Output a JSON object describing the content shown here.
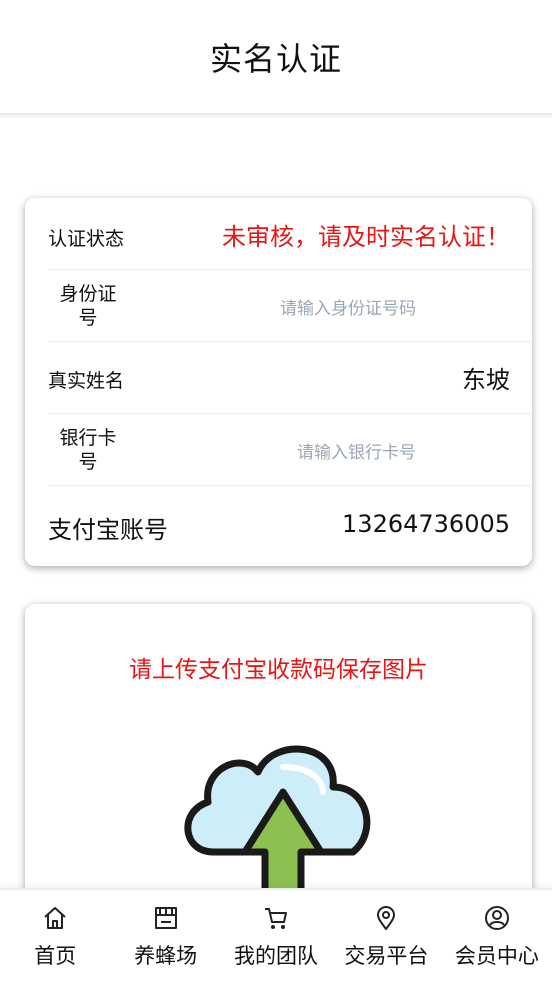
{
  "header": {
    "title": "实名认证"
  },
  "verification": {
    "status_label": "认证状态",
    "status_value": "未审核，请及时实名认证！",
    "id_label": "身份证号",
    "id_placeholder": "请输入身份证号码",
    "name_label": "真实姓名",
    "name_value": "东坡",
    "bank_label": "银行卡号",
    "bank_placeholder": "请输入银行卡号",
    "alipay_label": "支付宝账号",
    "alipay_value": "13264736005"
  },
  "upload": {
    "title": "请上传支付宝收款码保存图片",
    "icon": "cloud-upload-icon"
  },
  "tabbar": {
    "items": [
      {
        "label": "首页",
        "icon": "home-icon"
      },
      {
        "label": "养蜂场",
        "icon": "store-icon"
      },
      {
        "label": "我的团队",
        "icon": "cart-icon"
      },
      {
        "label": "交易平台",
        "icon": "location-icon"
      },
      {
        "label": "会员中心",
        "icon": "user-circle-icon"
      }
    ]
  },
  "colors": {
    "accent_red": "#e91515",
    "placeholder": "#9aa6b8",
    "cloud_fill": "#cdeef9",
    "arrow_fill": "#8cc152"
  }
}
